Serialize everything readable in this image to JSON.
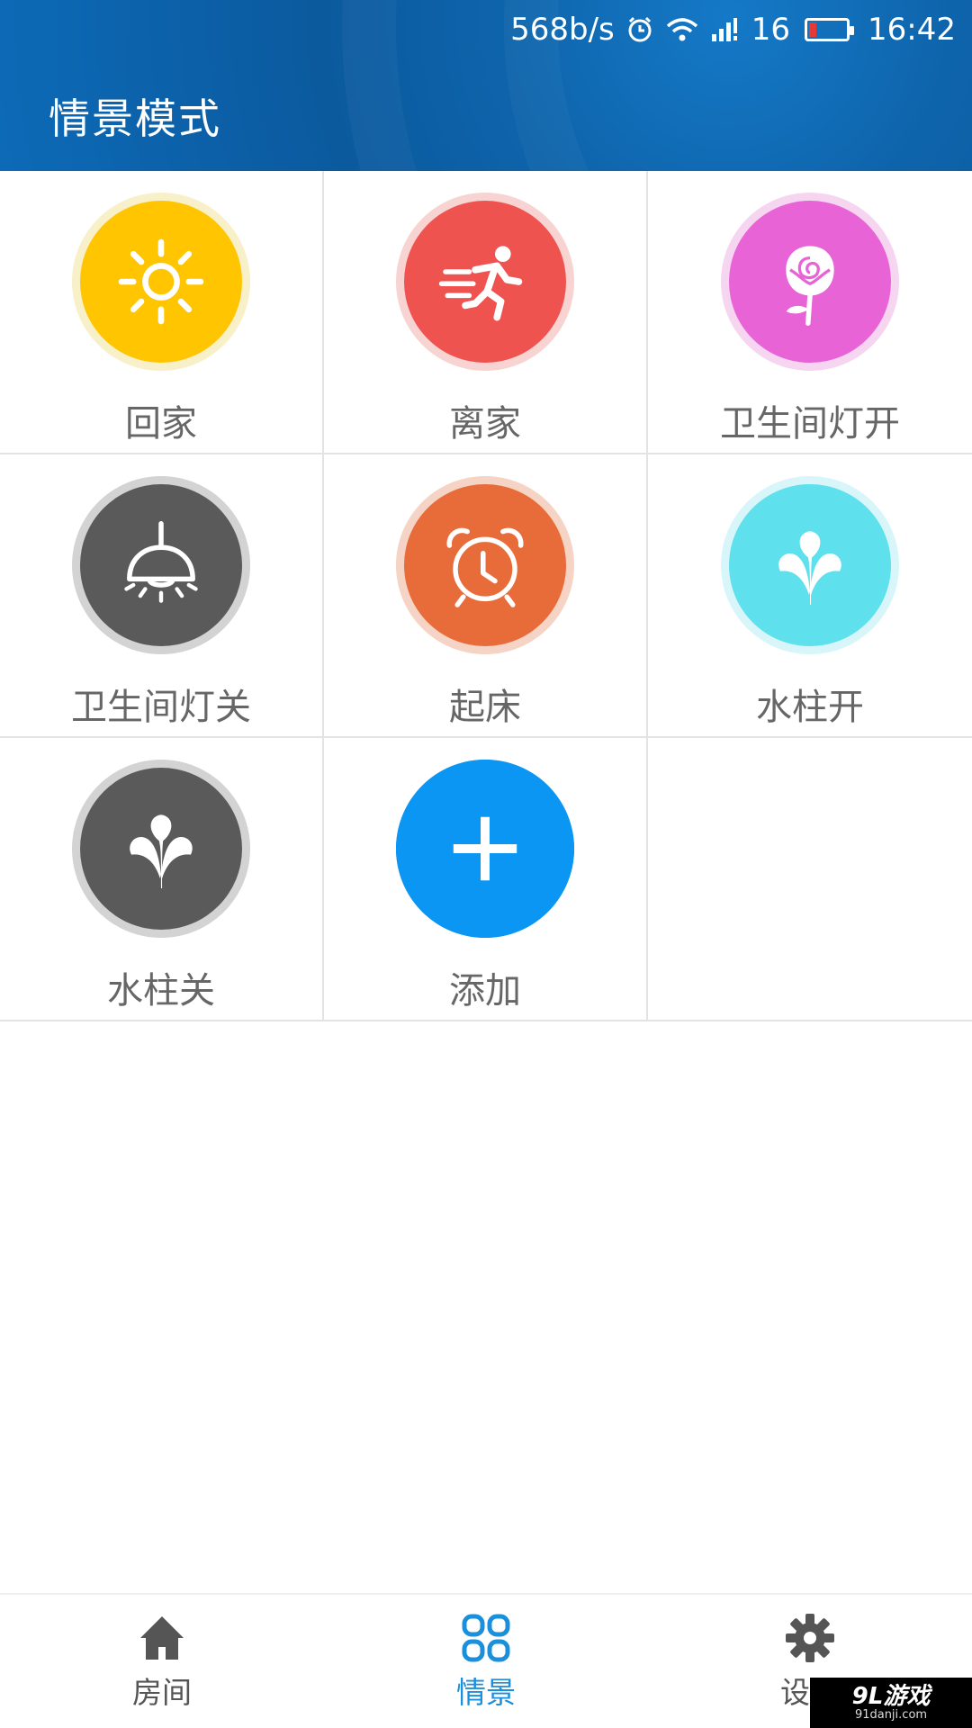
{
  "status_bar": {
    "speed": "568b/s",
    "signal_label": "16",
    "time": "16:42",
    "icons": [
      "alarm-icon",
      "wifi-icon",
      "signal-icon",
      "battery-icon"
    ]
  },
  "header": {
    "title": "情景模式"
  },
  "scenes": [
    {
      "label": "回家",
      "icon": "sun-icon",
      "color": "#ffc500",
      "ring": "#f7f0c8"
    },
    {
      "label": "离家",
      "icon": "running-person-icon",
      "color": "#ef5350",
      "ring": "#f7d3d1"
    },
    {
      "label": "卫生间灯开",
      "icon": "rose-icon",
      "color": "#e863d6",
      "ring": "#f6d5f1"
    },
    {
      "label": "卫生间灯关",
      "icon": "ceiling-lamp-icon",
      "color": "#5a5a5a",
      "ring": "#d3d3d3"
    },
    {
      "label": "起床",
      "icon": "alarm-clock-icon",
      "color": "#e86b3a",
      "ring": "#f5d3c5"
    },
    {
      "label": "水柱开",
      "icon": "fountain-icon",
      "color": "#5fe0ed",
      "ring": "#d8f6f9"
    },
    {
      "label": "水柱关",
      "icon": "fountain-icon",
      "color": "#5a5a5a",
      "ring": "#d3d3d3"
    },
    {
      "label": "添加",
      "icon": "plus-icon",
      "color": "#0a96f2",
      "ring": "#0a96f2"
    }
  ],
  "bottom_nav": {
    "items": [
      {
        "label": "房间",
        "icon": "home-icon"
      },
      {
        "label": "情景",
        "icon": "grid-icon"
      },
      {
        "label": "设置",
        "icon": "gear-icon"
      }
    ],
    "active_index": 1,
    "active_color": "#1a8fdc",
    "inactive_color": "#555555"
  },
  "watermark": {
    "main": "9L游戏",
    "sub": "91danji.com"
  }
}
